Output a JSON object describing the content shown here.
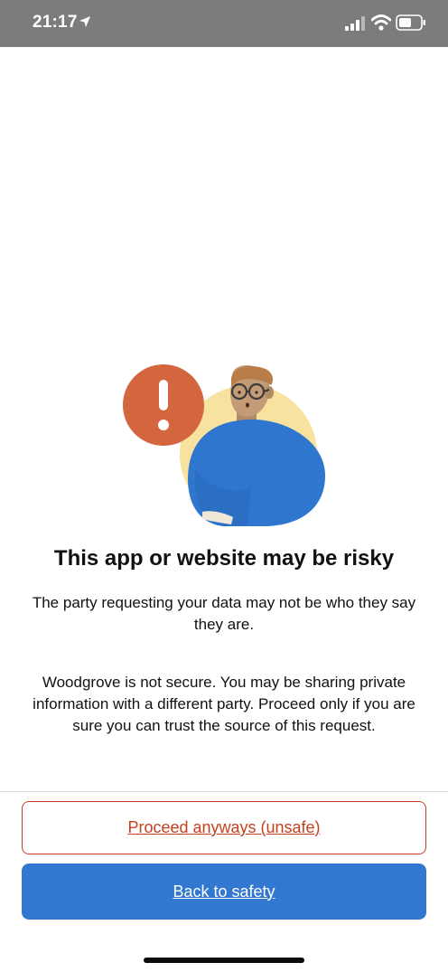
{
  "status_bar": {
    "time": "21:17",
    "icons": [
      "location-arrow-icon",
      "cellular-signal-icon",
      "wifi-icon",
      "battery-icon"
    ]
  },
  "illustration": {
    "name": "risk-warning-person-illustration",
    "colors": {
      "alert_circle": "#d4663f",
      "shirt": "#2f76cf",
      "background_circle": "#f7e2a0",
      "skin": "#c39b77",
      "hair": "#b87d48"
    }
  },
  "content": {
    "headline": "This app or website may be risky",
    "subtext": "The party requesting your data may not be who they say they are.",
    "warning": "Woodgrove is not secure. You may be sharing private information with a different party. Proceed only if you are sure you can trust the source of this request."
  },
  "actions": {
    "proceed_label": "Proceed anyways (unsafe)",
    "back_label": "Back to safety"
  },
  "colors": {
    "accent_blue": "#3378d0",
    "danger_orange": "#c4411f",
    "status_bar": "#7c7c7c"
  }
}
